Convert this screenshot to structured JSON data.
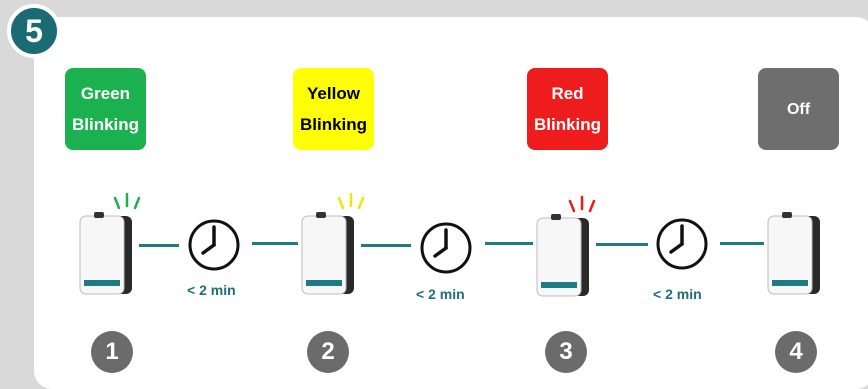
{
  "step": "5",
  "statuses": [
    {
      "line1": "Green",
      "line2": "Blinking",
      "color": "#1bb14f"
    },
    {
      "line1": "Yellow",
      "line2": "Blinking",
      "color": "#ffff00"
    },
    {
      "line1": "Red",
      "line2": "Blinking",
      "color": "#ee1c1c"
    },
    {
      "line1": "Off",
      "line2": "",
      "color": "#6e6e6e"
    }
  ],
  "interval_label": "< 2 min",
  "numbers": [
    "1",
    "2",
    "3",
    "4"
  ],
  "icons": {
    "clock": "clock-icon",
    "device": "device-icon",
    "light": "blink-rays-icon"
  },
  "accent_color": "#1f7b83"
}
